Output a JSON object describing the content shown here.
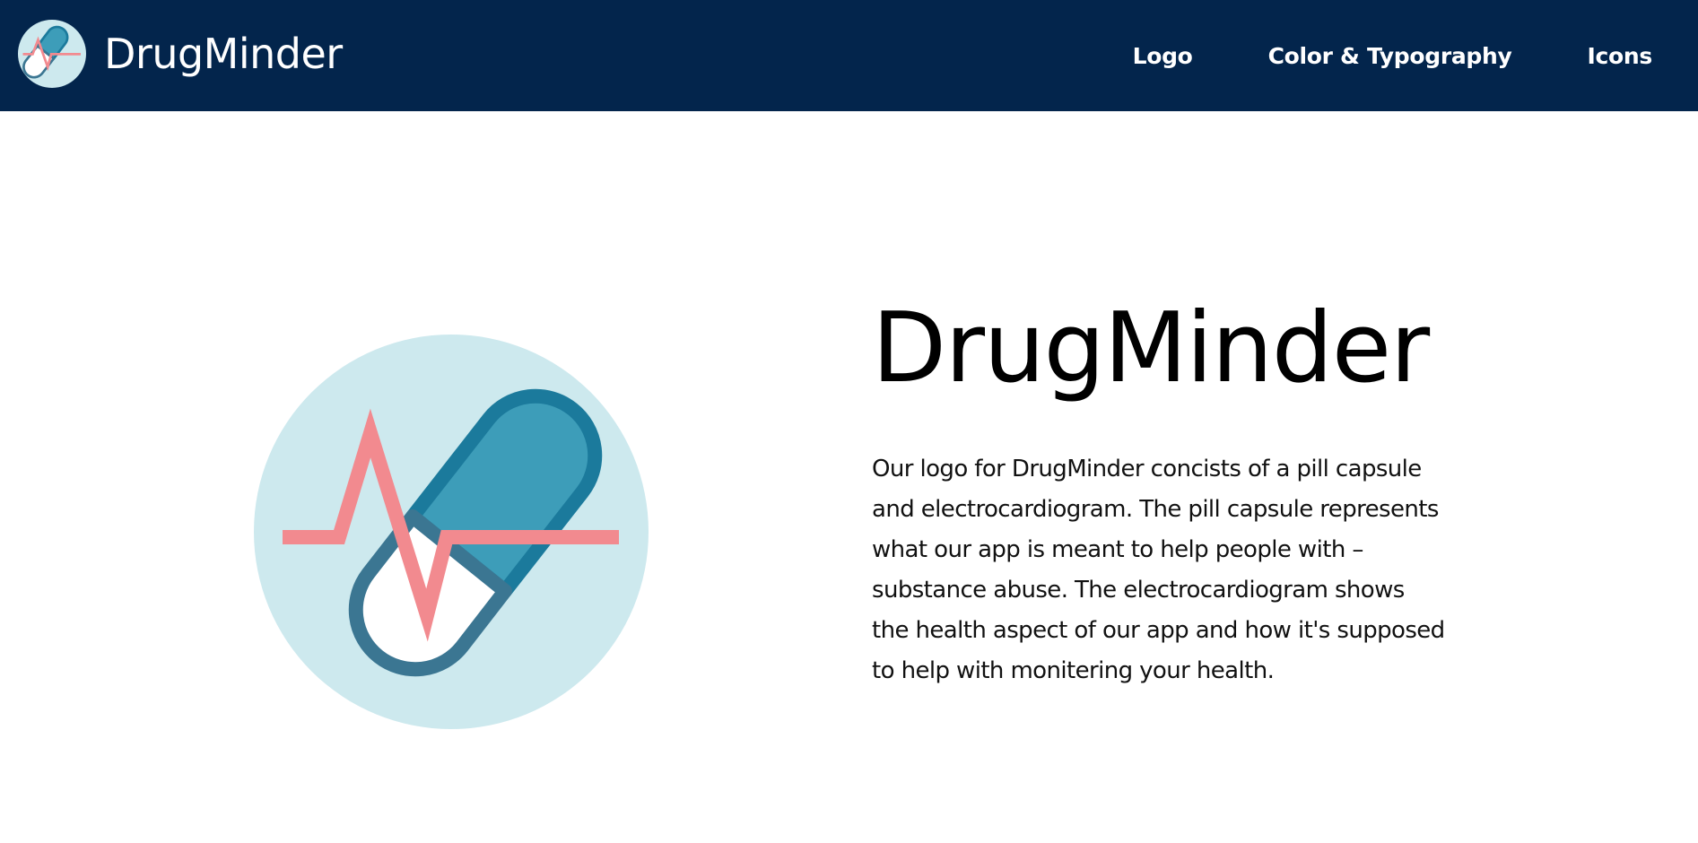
{
  "nav": {
    "brand_name": "DrugMinder",
    "links": [
      {
        "label": "Logo"
      },
      {
        "label": "Color & Typography"
      },
      {
        "label": "Icons"
      }
    ]
  },
  "hero": {
    "title": "DrugMinder",
    "description": "Our logo for DrugMinder concists of a pill capsule and electrocardiogram. The pill capsule represents what our app is meant to help people with – substance abuse. The electrocardiogram shows the health aspect of our app and how it's supposed to help with monitering your health."
  },
  "colors": {
    "navbar_bg": "#03254c",
    "logo_circle": "#cde9ee",
    "capsule_fill": "#3d9db9",
    "capsule_outline": "#1b7a9c",
    "capsule_bottom_outline": "#3b7692",
    "ecg_line": "#f28a8f"
  },
  "icons": {
    "brand_logo": "pill-capsule-ecg-icon",
    "hero_logo": "pill-capsule-ecg-icon"
  }
}
